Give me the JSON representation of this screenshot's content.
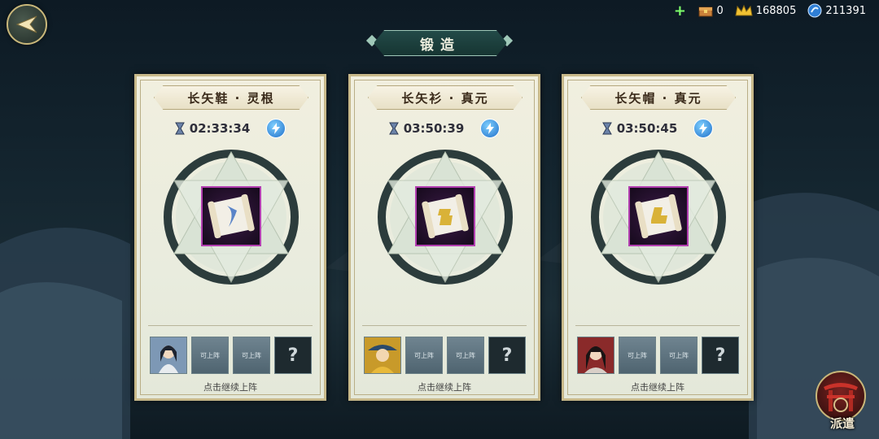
{
  "header": {
    "title": "锻造",
    "resources": [
      {
        "icon": "chest-icon",
        "value": "0"
      },
      {
        "icon": "crown-icon",
        "value": "168805"
      },
      {
        "icon": "gem-icon",
        "value": "211391"
      }
    ]
  },
  "cards": [
    {
      "name": "长矢鞋 · 灵根",
      "timer": "02:33:34",
      "item_icon": "blue-scroll-icon",
      "slots": [
        {
          "type": "hero",
          "label": ""
        },
        {
          "type": "empty",
          "label": "可上阵"
        },
        {
          "type": "empty",
          "label": "可上阵"
        },
        {
          "type": "locked",
          "label": "?"
        }
      ],
      "hint": "点击继续上阵"
    },
    {
      "name": "长矢衫 · 真元",
      "timer": "03:50:39",
      "item_icon": "gold-scroll-icon",
      "slots": [
        {
          "type": "hero",
          "label": ""
        },
        {
          "type": "empty",
          "label": "可上阵"
        },
        {
          "type": "empty",
          "label": "可上阵"
        },
        {
          "type": "locked",
          "label": "?"
        }
      ],
      "hint": "点击继续上阵"
    },
    {
      "name": "长矢帽 · 真元",
      "timer": "03:50:45",
      "item_icon": "gold-scroll-icon",
      "slots": [
        {
          "type": "hero",
          "label": ""
        },
        {
          "type": "empty",
          "label": "可上阵"
        },
        {
          "type": "empty",
          "label": "可上阵"
        },
        {
          "type": "locked",
          "label": "?"
        }
      ],
      "hint": "点击继续上阵"
    }
  ],
  "dispatch": {
    "label": "派遣"
  },
  "colors": {
    "accent_teal": "#234a48",
    "card_bg": "#f1efdf",
    "item_border": "#b23fb0",
    "speed_blue": "#1f6fc9"
  }
}
